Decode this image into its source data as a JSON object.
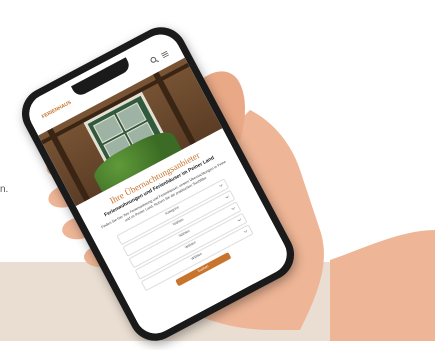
{
  "caption_fragment": "n.",
  "site": {
    "logo_text": "FERIENHAUS",
    "header_icons": [
      "search-icon",
      "menu-icon"
    ]
  },
  "content": {
    "section_title": "Ihre Übernachtungsanbieter",
    "sub_title": "Ferienwohnungen und Ferienhäuser im Peiner Land",
    "intro": "Finden Sie hier Ihre Ferienwohnung und Ferienhäuser, unsere Übernachtungen in Peine und im Peiner Land. Nutzen Sie die praktischen Suchfilter.",
    "fields": [
      "Kategorie",
      "Wählen",
      "Wählen",
      "Wählen",
      "Wählen"
    ],
    "submit_label": "Suchen"
  },
  "colors": {
    "accent": "#c8742c",
    "band": "#eaded2",
    "skin": "#eeb596"
  }
}
